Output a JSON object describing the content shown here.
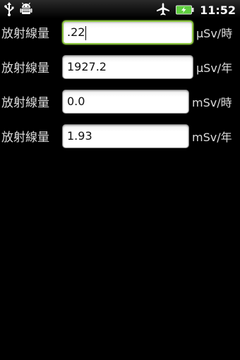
{
  "status_bar": {
    "icons_left": [
      "usb-icon",
      "android-debug-icon"
    ],
    "icons_right": [
      "airplane-mode-icon",
      "battery-charging-icon"
    ],
    "time": "11:52",
    "battery_color": "#5fcf3f"
  },
  "rows": [
    {
      "label": "放射線量",
      "value": ".22",
      "unit": "μSv/時",
      "focused": true
    },
    {
      "label": "放射線量",
      "value": "1927.2",
      "unit": "μSv/年",
      "focused": false
    },
    {
      "label": "放射線量",
      "value": "0.0",
      "unit": "mSv/時",
      "focused": false
    },
    {
      "label": "放射線量",
      "value": "1.93",
      "unit": "mSv/年",
      "focused": false
    }
  ],
  "colors": {
    "background": "#000000",
    "focus_border": "#8cc63f"
  }
}
